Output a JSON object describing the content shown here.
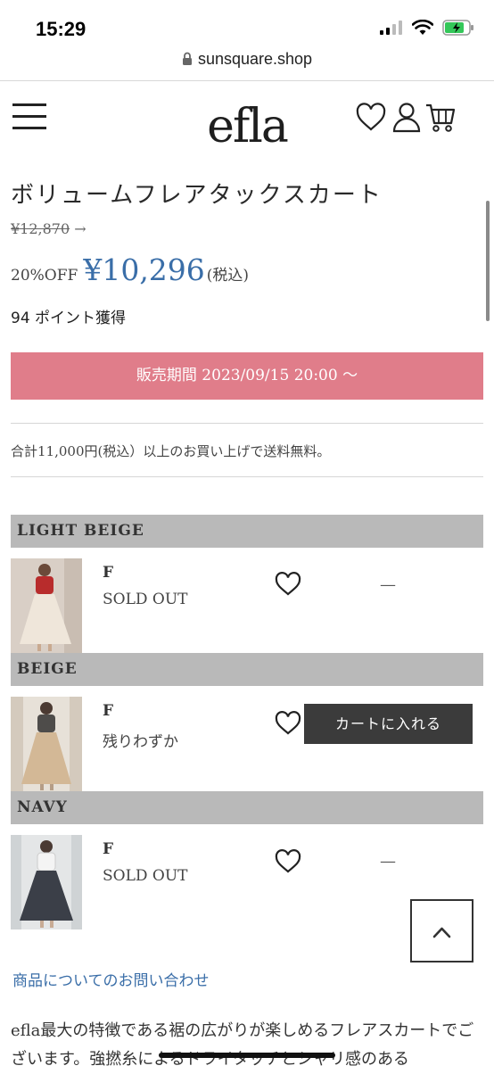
{
  "status": {
    "time": "15:29"
  },
  "browser": {
    "url": "sunsquare.shop"
  },
  "header": {
    "logo": "efla"
  },
  "product": {
    "title": "ボリュームフレアタックスカート",
    "original_price": "¥12,870",
    "arrow": "→",
    "discount": "20%OFF",
    "price": "¥10,296",
    "tax_note": "(税込)",
    "points": "94 ポイント獲得",
    "sale_period": "販売期間 2023/09/15 20:00 〜",
    "shipping_note": "合計11,000円(税込）以上のお買い上げで送料無料。"
  },
  "variants": [
    {
      "color": "LIGHT BEIGE",
      "size": "F",
      "stock": "SOLD OUT",
      "action": "—"
    },
    {
      "color": "BEIGE",
      "size": "F",
      "stock": "残りわずか",
      "action": "カートに入れる"
    },
    {
      "color": "NAVY",
      "size": "F",
      "stock": "SOLD OUT",
      "action": "—"
    }
  ],
  "links": {
    "inquiry": "商品についてのお問い合わせ"
  },
  "description": "efla最大の特徴である裾の広がりが楽しめるフレアスカートでございます。強撚糸によるドライタッチとシャリ感のある",
  "colors": {
    "accent_pink": "#e07d8a",
    "price_blue": "#3a6ea8",
    "variant_header": "#b9b9b9",
    "cart_button": "#3b3b3b"
  }
}
